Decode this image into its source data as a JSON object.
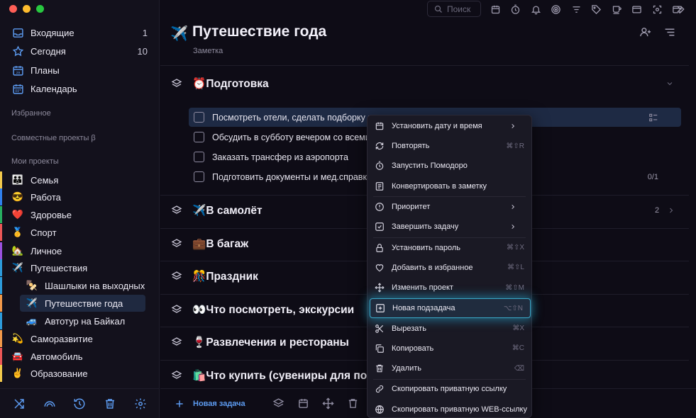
{
  "sidebar": {
    "nav": [
      {
        "label": "Входящие",
        "count": "1",
        "icon": "inbox-icon"
      },
      {
        "label": "Сегодня",
        "count": "10",
        "icon": "star-icon"
      },
      {
        "label": "Планы",
        "count": "",
        "icon": "calendar-29-icon"
      },
      {
        "label": "Календарь",
        "count": "",
        "icon": "calendar-icon"
      }
    ],
    "favorites_label": "Избранное",
    "shared_label": "Совместные проекты β",
    "my_projects_label": "Мои проекты",
    "projects": [
      {
        "emoji": "👪",
        "label": "Семья",
        "color": "#f2c94c",
        "level": 1
      },
      {
        "emoji": "😎",
        "label": "Работа",
        "color": "#2f80ed",
        "level": 1
      },
      {
        "emoji": "❤️",
        "label": "Здоровье",
        "color": "#27ae60",
        "level": 1
      },
      {
        "emoji": "🥇",
        "label": "Спорт",
        "color": "#eb5757",
        "level": 1
      },
      {
        "emoji": "🏡",
        "label": "Личное",
        "color": "#9b51e0",
        "level": 1
      },
      {
        "emoji": "✈️",
        "label": "Путешествия",
        "color": "#2d9cdb",
        "level": 1
      },
      {
        "emoji": "🍢",
        "label": "Шашлыки на выходных",
        "color": "#2d9cdb",
        "level": 2
      },
      {
        "emoji": "✈️",
        "label": "Путешествие года",
        "color": "#f2994a",
        "level": 2
      },
      {
        "emoji": "🚙",
        "label": "Автотур на Байкал",
        "color": "#2d9cdb",
        "level": 2
      },
      {
        "emoji": "💫",
        "label": "Саморазвитие",
        "color": "#f2994a",
        "level": 1
      },
      {
        "emoji": "🚘",
        "label": "Автомобиль",
        "color": "#eb5757",
        "level": 1
      },
      {
        "emoji": "✌️",
        "label": "Образование",
        "color": "#f2c94c",
        "level": 1
      }
    ],
    "bottom_icons": [
      "shuffle-icon",
      "rainbow-icon",
      "history-icon",
      "trash-icon",
      "settings-icon"
    ]
  },
  "toolbar": {
    "search_placeholder": "Поиск",
    "icons": [
      "calendar-icon",
      "timer-icon",
      "bell-icon",
      "target-icon",
      "filter-icon",
      "tag-icon",
      "cup-icon",
      "window-icon",
      "scan-icon",
      "window-plus-icon"
    ],
    "collapse_icon": "double-chevron-right-icon"
  },
  "page": {
    "emoji": "✈️",
    "title": "Путешествие года",
    "type_label": "Заметка",
    "header_icons": [
      "add-user-icon",
      "sort-lines-icon"
    ]
  },
  "sections": [
    {
      "emoji": "⏰",
      "title": "Подготовка",
      "count": ""
    },
    {
      "emoji": "✈️",
      "title": "В самолёт",
      "count": "2"
    },
    {
      "emoji": "💼",
      "title": "В багаж",
      "count": ""
    },
    {
      "emoji": "🎊",
      "title": "Праздник",
      "count": ""
    },
    {
      "emoji": "👀",
      "title": "Что посмотреть, экскурсии",
      "count": ""
    },
    {
      "emoji": "🍷",
      "title": "Развлечения и рестораны",
      "count": ""
    },
    {
      "emoji": "🛍️",
      "title": "Что купить (сувениры для пода",
      "count": ""
    }
  ],
  "tasks": [
    {
      "title": "Посмотреть отели, сделать подборку и",
      "meta": ""
    },
    {
      "title": "Обсудить в субботу вечером со всеми з",
      "meta": ""
    },
    {
      "title": "Заказать трансфер из аэропорта",
      "meta": ""
    },
    {
      "title": "Подготовить документы и мед.справки",
      "meta": "0/1"
    }
  ],
  "bottombar": {
    "new_task_label": "Новая задача",
    "icons": [
      "layers-icon",
      "calendar-icon",
      "move-icon",
      "trash-icon"
    ]
  },
  "context_menu": [
    {
      "label": "Установить дату и время",
      "shortcut": "",
      "submenu": true,
      "icon": "calendar-icon"
    },
    {
      "label": "Повторять",
      "shortcut": "⌘⇧R",
      "submenu": false,
      "icon": "repeat-icon"
    },
    {
      "label": "Запустить Помодоро",
      "shortcut": "",
      "submenu": false,
      "icon": "timer-icon"
    },
    {
      "label": "Конвертировать в заметку",
      "shortcut": "",
      "submenu": false,
      "icon": "note-icon"
    },
    {
      "label": "Приоритет",
      "shortcut": "",
      "submenu": true,
      "icon": "priority-icon"
    },
    {
      "label": "Завершить задачу",
      "shortcut": "",
      "submenu": true,
      "icon": "check-square-icon"
    },
    {
      "label": "Установить пароль",
      "shortcut": "⌘⇧X",
      "submenu": false,
      "icon": "lock-icon"
    },
    {
      "label": "Добавить в избранное",
      "shortcut": "⌘⇧L",
      "submenu": false,
      "icon": "heart-icon"
    },
    {
      "label": "Изменить проект",
      "shortcut": "⌘⇧M",
      "submenu": false,
      "icon": "move-icon"
    },
    {
      "label": "Новая подзадача",
      "shortcut": "⌥⇧N",
      "submenu": false,
      "icon": "plus-square-icon"
    },
    {
      "label": "Вырезать",
      "shortcut": "⌘X",
      "submenu": false,
      "icon": "scissors-icon"
    },
    {
      "label": "Копировать",
      "shortcut": "⌘C",
      "submenu": false,
      "icon": "copy-icon"
    },
    {
      "label": "Удалить",
      "shortcut": "⌫",
      "submenu": false,
      "icon": "trash-icon"
    },
    {
      "label": "Скопировать приватную ссылку",
      "shortcut": "",
      "submenu": false,
      "icon": "link-icon"
    },
    {
      "label": "Скопировать приватную WEB-ссылку",
      "shortcut": "",
      "submenu": false,
      "icon": "globe-icon"
    }
  ],
  "colors": {
    "accent": "#5d9cf2",
    "highlight_glow": "#3aa9c9",
    "background": "#0e0c16",
    "sidebar": "#13111c"
  }
}
